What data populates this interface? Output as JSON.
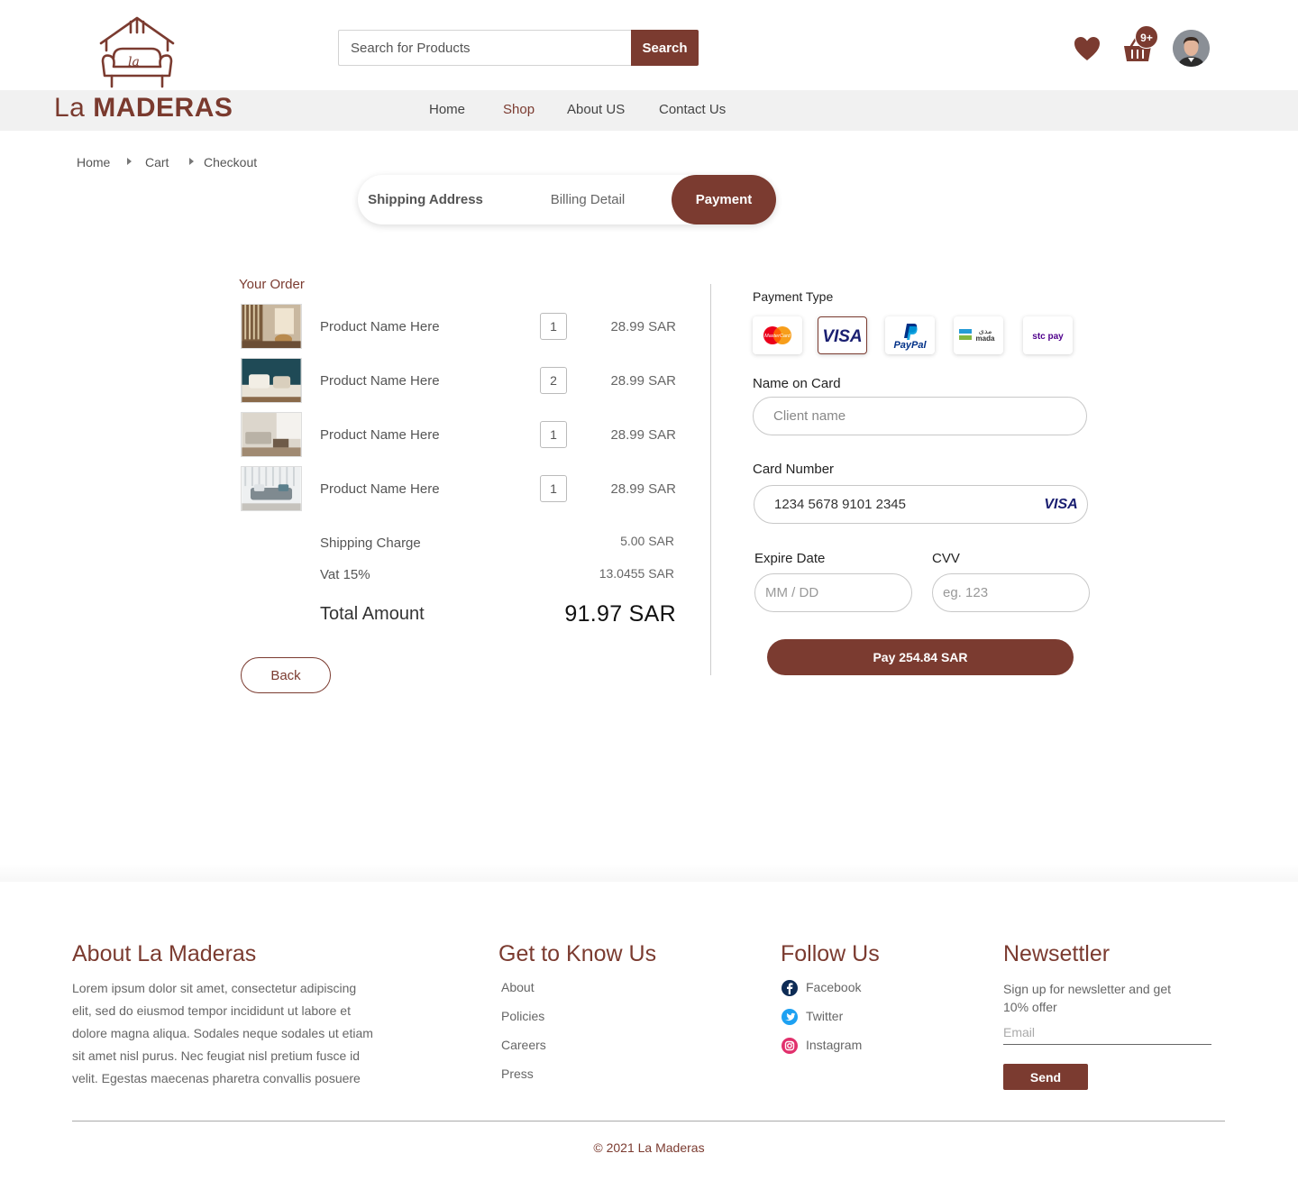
{
  "brand": {
    "name_light": "La",
    "name_bold": "MADERAS",
    "accent_color": "#7b3b30"
  },
  "header": {
    "search_placeholder": "Search for Products",
    "search_button": "Search",
    "cart_badge": "9+",
    "icons": [
      "logo-icon",
      "heart-icon",
      "cart-icon",
      "avatar"
    ]
  },
  "nav": {
    "items": [
      {
        "label": "Home"
      },
      {
        "label": "Shop",
        "active": true
      },
      {
        "label": "About US"
      },
      {
        "label": "Contact Us"
      }
    ]
  },
  "breadcrumb": [
    "Home",
    "Cart",
    "Checkout"
  ],
  "steps": [
    {
      "label": "Shipping Address"
    },
    {
      "label": "Billing Detail"
    },
    {
      "label": "Payment",
      "active": true
    }
  ],
  "order": {
    "title": "Your Order",
    "items": [
      {
        "name": "Product Name Here",
        "qty": "1",
        "price": "28.99 SAR"
      },
      {
        "name": "Product Name Here",
        "qty": "2",
        "price": "28.99 SAR"
      },
      {
        "name": "Product Name Here",
        "qty": "1",
        "price": "28.99 SAR"
      },
      {
        "name": "Product Name Here",
        "qty": "1",
        "price": "28.99 SAR"
      }
    ],
    "shipping_label": "Shipping Charge",
    "shipping_value": "5.00 SAR",
    "vat_label": "Vat 15%",
    "vat_value": "13.0455 SAR",
    "total_label": "Total Amount",
    "total_value": "91.97 SAR",
    "back_button": "Back"
  },
  "payment": {
    "type_label": "Payment Type",
    "methods": [
      {
        "name": "mastercard",
        "text": "MasterCard"
      },
      {
        "name": "visa",
        "text": "VISA",
        "selected": true
      },
      {
        "name": "paypal",
        "text": "PayPal"
      },
      {
        "name": "mada",
        "text": "mada"
      },
      {
        "name": "stcpay",
        "text": "stc pay"
      }
    ],
    "name_label": "Name on Card",
    "name_placeholder": "Client name",
    "card_label": "Card Number",
    "card_value": "1234 5678 9101 2345",
    "card_brand": "VISA",
    "expire_label": "Expire Date",
    "expire_placeholder": "MM / DD",
    "cvv_label": "CVV",
    "cvv_placeholder": "eg. 123",
    "pay_button": "Pay 254.84 SAR"
  },
  "footer": {
    "about_title": "About La Maderas",
    "about_text": "Lorem ipsum dolor sit amet, consectetur adipiscing elit, sed do eiusmod tempor incididunt ut labore et dolore magna aliqua. Sodales neque sodales ut etiam sit amet nisl purus. Nec feugiat nisl pretium fusce id velit. Egestas maecenas pharetra convallis posuere",
    "know_title": "Get to Know Us",
    "know_links": [
      "About",
      "Policies",
      "Careers",
      "Press"
    ],
    "follow_title": "Follow Us",
    "social": [
      {
        "label": "Facebook",
        "icon": "facebook-icon"
      },
      {
        "label": "Twitter",
        "icon": "twitter-icon"
      },
      {
        "label": "Instagram",
        "icon": "instagram-icon"
      }
    ],
    "newsletter_title": "Newsettler",
    "newsletter_text": "Sign up for newsletter and get 10% offer",
    "email_placeholder": "Email",
    "send_button": "Send",
    "copyright": "© 2021 La Maderas"
  }
}
